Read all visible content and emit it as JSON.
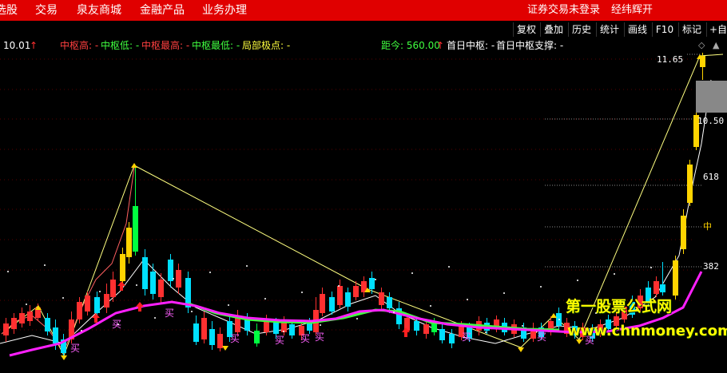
{
  "menu": {
    "items": [
      "选股",
      "交易",
      "泉友商城",
      "金融产品",
      "业务办理"
    ],
    "right_items": [
      "证券交易未登录",
      "经纬辉开"
    ]
  },
  "toolbar": {
    "buttons": [
      "复权",
      "叠加",
      "历史",
      "统计",
      "画线",
      "F10",
      "标记",
      "+自选"
    ]
  },
  "legend": {
    "price": "10.01",
    "zhongshu_high": "中枢高: -",
    "zhongshu_low": "中枢低: -",
    "zhongshu_max": "中枢最高: -",
    "zhongshu_min": "中枢最低: -",
    "local_extreme": "局部极点: -",
    "distance": "距今: 560.00",
    "first_zhongshu": "首日中枢: -",
    "first_support": "首日中枢支撑: -"
  },
  "colors": {
    "menu_bg": "#e00000",
    "up_candle": "#ff3030",
    "down_candle": "#00e0ff",
    "yellow_candle": "#ffd400",
    "green_candle": "#00ff40",
    "magenta_line": "#ff20ff",
    "green_line": "#40ff40",
    "zigzag_line": "#ffff80"
  },
  "annotations": {
    "buy_label": "买",
    "fib_618": "618",
    "fib_mid": "中",
    "fib_382": "382",
    "price_high": "11.65",
    "price_mark": "10.50"
  },
  "watermark": {
    "line1": "第一股票公式网",
    "line2": "www.chnmoney.com"
  }
}
